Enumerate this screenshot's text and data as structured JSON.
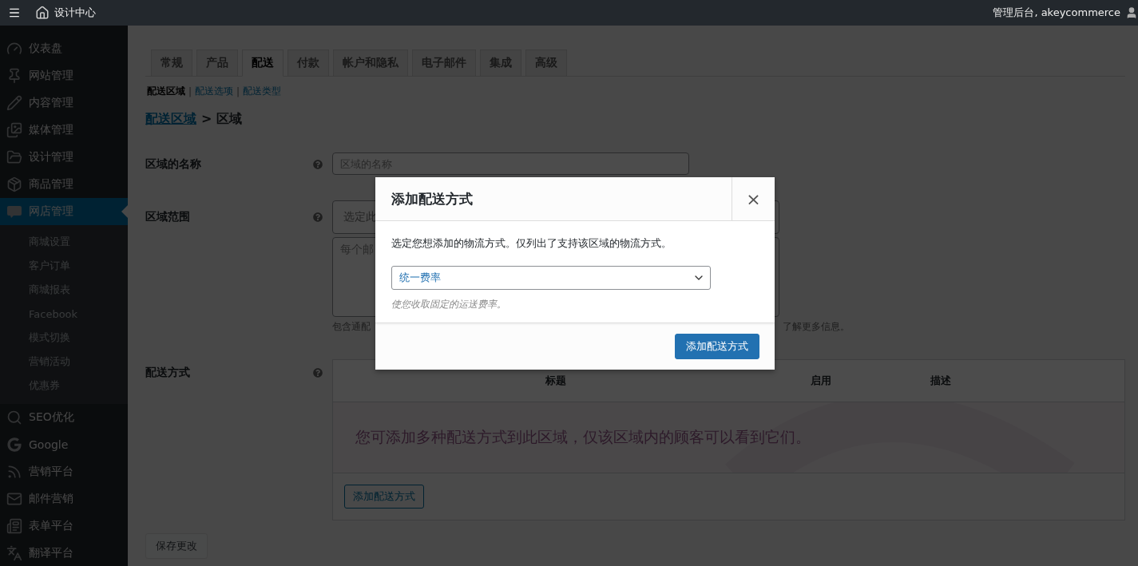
{
  "topbar": {
    "site_title": "设计中心",
    "account": "管理后台, akeycommerce"
  },
  "sidebar": {
    "items": [
      {
        "label": "仪表盘",
        "selected": false
      },
      {
        "label": "网站管理",
        "selected": false
      },
      {
        "label": "内容管理",
        "selected": false
      },
      {
        "label": "媒体管理",
        "selected": false
      },
      {
        "label": "设计管理",
        "selected": false
      },
      {
        "label": "商品管理",
        "selected": false
      },
      {
        "label": "网店管理",
        "selected": true,
        "children": [
          {
            "label": "商城设置"
          },
          {
            "label": "客户订单"
          },
          {
            "label": "商城报表"
          },
          {
            "label": "Facebook"
          },
          {
            "label": "模式切换"
          },
          {
            "label": "营销活动"
          },
          {
            "label": "优惠券"
          }
        ]
      },
      {
        "label": "SEO优化",
        "selected": false
      },
      {
        "label": "Google",
        "selected": false
      },
      {
        "label": "营销平台",
        "selected": false
      },
      {
        "label": "邮件营销",
        "selected": false
      },
      {
        "label": "表单平台",
        "selected": false
      },
      {
        "label": "翻译平台",
        "selected": false
      }
    ]
  },
  "tabs": [
    {
      "label": "常规",
      "selected": false
    },
    {
      "label": "产品",
      "selected": false
    },
    {
      "label": "配送",
      "selected": true
    },
    {
      "label": "付款",
      "selected": false
    },
    {
      "label": "帐户和隐私",
      "selected": false
    },
    {
      "label": "电子邮件",
      "selected": false
    },
    {
      "label": "集成",
      "selected": false
    },
    {
      "label": "高级",
      "selected": false
    }
  ],
  "sub_link_separator": "|",
  "sub_links": [
    {
      "label": "配送区域",
      "selected": true
    },
    {
      "label": "配送选项",
      "selected": false
    },
    {
      "label": "配送类型",
      "selected": false
    }
  ],
  "breadcrumb": {
    "link": "配送区域",
    "current": "> 区域"
  },
  "form": {
    "zone_name": {
      "label": "区域的名称",
      "placeholder": "区域的名称"
    },
    "zone_regions": {
      "label": "区域范围",
      "placeholder": "选定此",
      "postcodes_placeholder": "每个邮",
      "help_start": "包含通配",
      "help_end": "了解更多信息。"
    },
    "shipping_methods": {
      "label": "配送方式",
      "columns": [
        "标题",
        "启用",
        "描述"
      ],
      "blank_message": "您可添加多种配送方式到此区域，仅该区域内的顾客可以看到它们。",
      "add_button": "添加配送方式"
    }
  },
  "save_button": {
    "label": "保存更改",
    "disabled": true
  },
  "modal": {
    "title": "添加配送方式",
    "close": "×",
    "intro": "选定您想添加的物流方式。仅列出了支持该区域的物流方式。",
    "method": "统一费率",
    "description": "使您收取固定的运送费率。",
    "submit": "添加配送方式"
  }
}
